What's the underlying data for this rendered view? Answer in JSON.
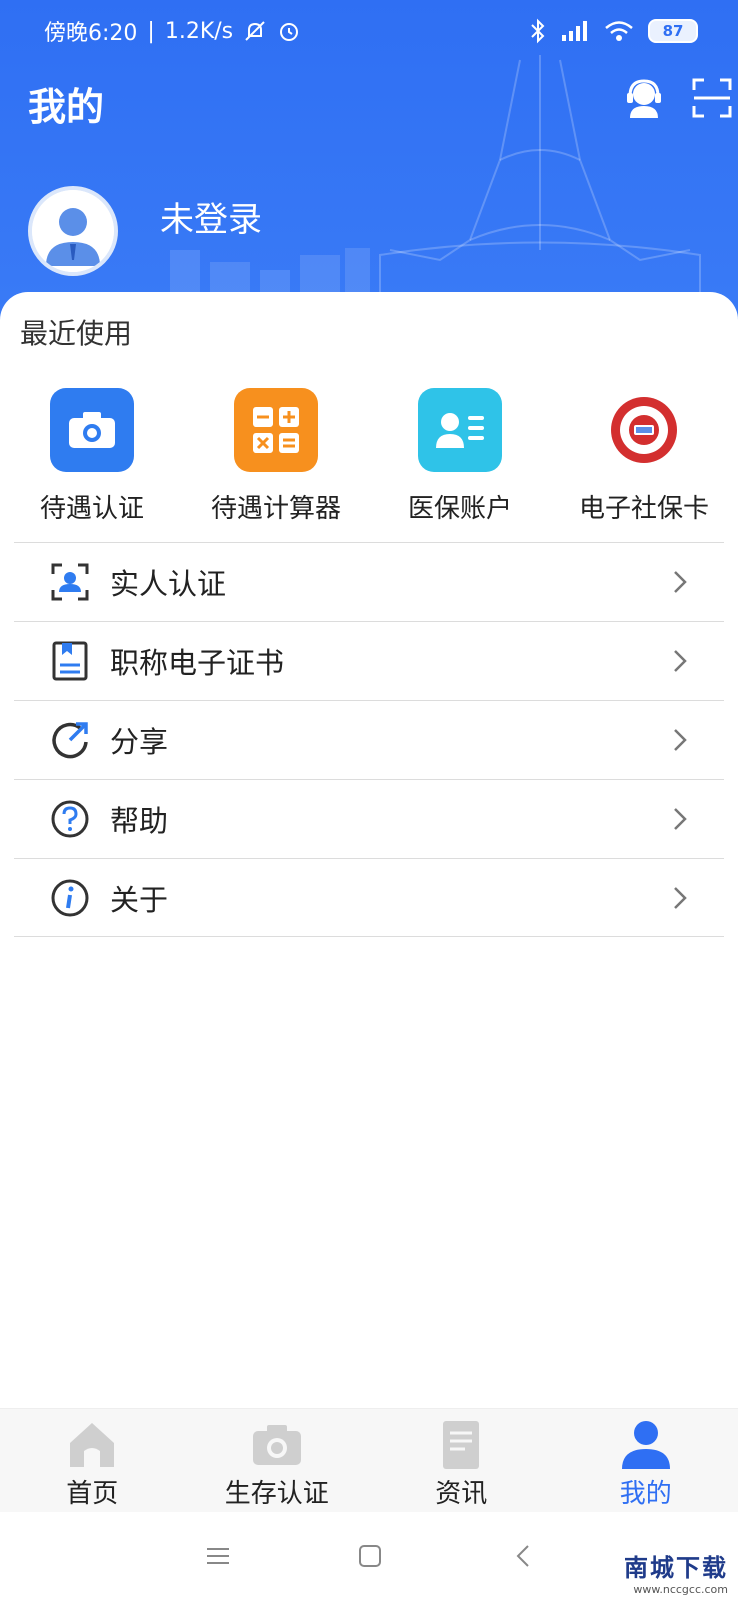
{
  "status": {
    "time": "傍晚6:20",
    "speed": "1.2K/s",
    "battery": "87"
  },
  "header": {
    "title": "我的",
    "login_text": "未登录"
  },
  "recent": {
    "title": "最近使用",
    "items": [
      {
        "label": "待遇认证",
        "icon": "camera-icon",
        "color": "#2f7cf0"
      },
      {
        "label": "待遇计算器",
        "icon": "calculator-icon",
        "color": "#f7901e"
      },
      {
        "label": "医保账户",
        "icon": "id-card-icon",
        "color": "#2fc3e8"
      },
      {
        "label": "电子社保卡",
        "icon": "social-security-card-icon",
        "color": "#d32f2f"
      }
    ]
  },
  "menu": [
    {
      "label": "实人认证",
      "icon": "face-verify-icon"
    },
    {
      "label": "职称电子证书",
      "icon": "certificate-icon"
    },
    {
      "label": "分享",
      "icon": "share-icon"
    },
    {
      "label": "帮助",
      "icon": "help-icon"
    },
    {
      "label": "关于",
      "icon": "info-icon"
    }
  ],
  "tabs": [
    {
      "label": "首页",
      "icon": "home-icon",
      "active": false
    },
    {
      "label": "生存认证",
      "icon": "camera-icon",
      "active": false
    },
    {
      "label": "资讯",
      "icon": "news-icon",
      "active": false
    },
    {
      "label": "我的",
      "icon": "person-icon",
      "active": true
    }
  ],
  "watermark": {
    "main": "南城下载",
    "sub": "www.nccgcc.com"
  },
  "colors": {
    "primary": "#2f6ff3",
    "inactive_tab": "#cfcfcf"
  }
}
